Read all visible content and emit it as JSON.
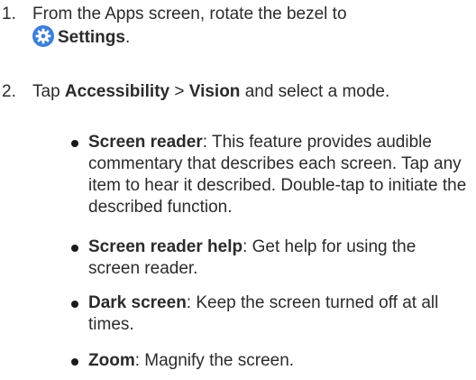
{
  "steps": [
    {
      "number": "1.",
      "text_before": "From the Apps screen, rotate the bezel to",
      "icon": "settings-gear-icon",
      "bold_term": "Settings",
      "text_after": "."
    },
    {
      "number": "2.",
      "text_before": "Tap ",
      "bold_term_1": "Accessibility",
      "separator": " > ",
      "bold_term_2": "Vision",
      "text_after": " and select a mode."
    }
  ],
  "modes": [
    {
      "term": "Screen reader",
      "description": ": This feature provides audible commentary that describes each screen. Tap any item to hear it described. Double-tap to initiate the described function."
    },
    {
      "term": "Screen reader help",
      "description": ": Get help for using the screen reader."
    },
    {
      "term": "Dark screen",
      "description": ": Keep the screen turned off at all times."
    },
    {
      "term": "Zoom",
      "description": ": Magnify the screen."
    }
  ],
  "colors": {
    "text": "#2b2b2b",
    "icon_bg": "#3d7fd9",
    "icon_fg": "#ffffff"
  }
}
